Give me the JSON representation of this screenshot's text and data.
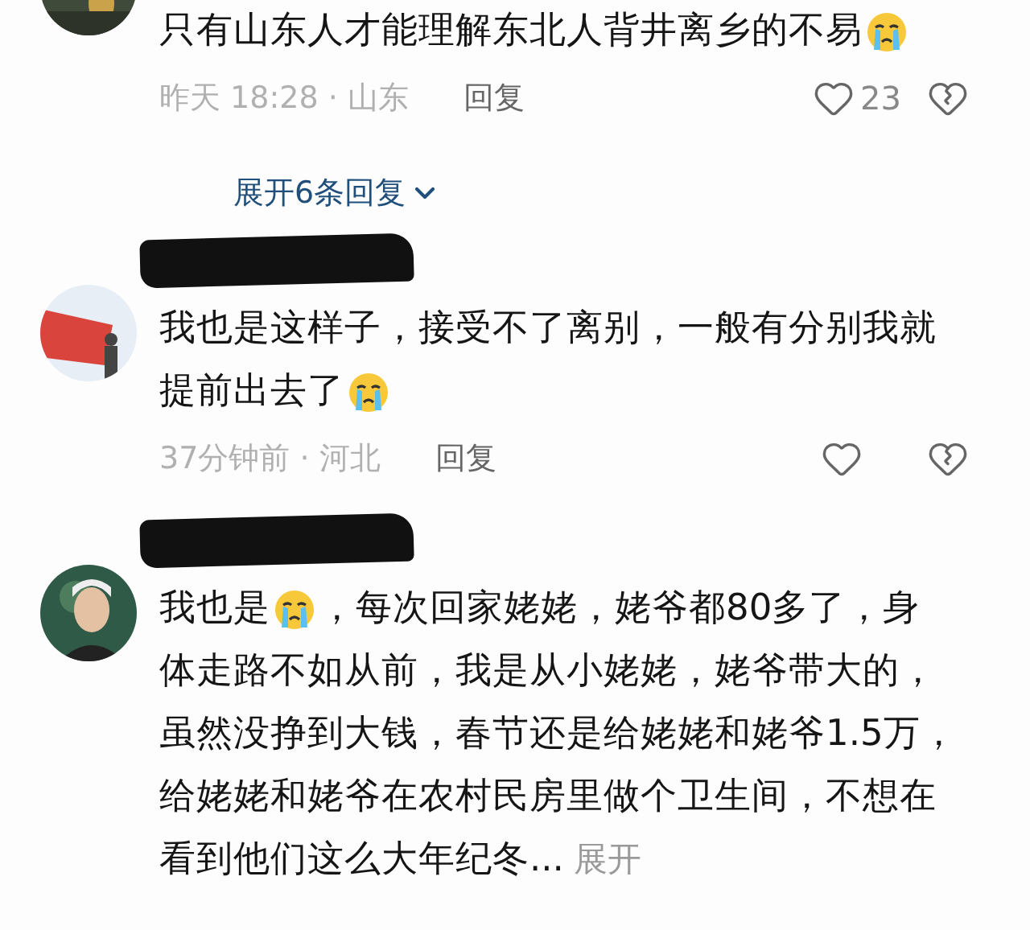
{
  "comments": [
    {
      "avatar": {
        "kind": "picture"
      },
      "redacted_name": false,
      "lines": [
        [
          {
            "kind": "text",
            "text": "只有山东人才能理解东北人背井离乡的不易"
          },
          {
            "kind": "emoji"
          }
        ]
      ],
      "time": "昨天 18:28 · 山东",
      "reply": "回复",
      "likes": "23",
      "replies": "展开6条回复"
    },
    {
      "avatar": {
        "kind": "picture"
      },
      "redacted_name": true,
      "lines": [
        [
          {
            "kind": "text",
            "text": "我也是这样子，接受不了离别，一般有分别我就"
          }
        ],
        [
          {
            "kind": "text",
            "text": "提前出去了"
          },
          {
            "kind": "emoji"
          }
        ]
      ],
      "time": "37分钟前 · 河北",
      "reply": "回复"
    },
    {
      "avatar": {
        "kind": "picture"
      },
      "redacted_name": true,
      "lines": [
        [
          {
            "kind": "text",
            "text": "我也是"
          },
          {
            "kind": "emoji"
          },
          {
            "kind": "text",
            "text": "，每次回家姥姥，姥爷都80多了，身"
          }
        ],
        [
          {
            "kind": "text",
            "text": "体走路不如从前，我是从小姥姥，姥爷带大的，"
          }
        ],
        [
          {
            "kind": "text",
            "text": "虽然没挣到大钱，春节还是给姥姥和姥爷1.5万，"
          }
        ],
        [
          {
            "kind": "text",
            "text": "给姥姥和姥爷在农村民房里做个卫生间，不想在"
          }
        ],
        [
          {
            "kind": "text",
            "text": "看到他们这么大年纪冬..."
          },
          {
            "kind": "more",
            "text": "展开"
          }
        ]
      ]
    }
  ]
}
